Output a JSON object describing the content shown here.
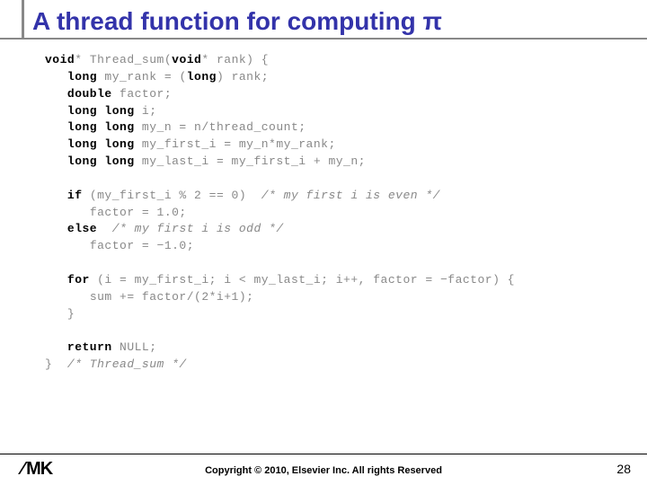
{
  "slide": {
    "title": "A thread function for computing π",
    "copyright": "Copyright © 2010, Elsevier Inc. All rights Reserved",
    "page_number": "28",
    "logo_text": "MK"
  },
  "code": {
    "lines": [
      {
        "indent": 0,
        "segs": [
          {
            "t": "void",
            "c": "kw"
          },
          {
            "t": "* Thread_sum("
          },
          {
            "t": "void",
            "c": "kw"
          },
          {
            "t": "* rank) {"
          }
        ]
      },
      {
        "indent": 1,
        "segs": [
          {
            "t": "long",
            "c": "kw"
          },
          {
            "t": " my_rank = ("
          },
          {
            "t": "long",
            "c": "kw"
          },
          {
            "t": ") rank;"
          }
        ]
      },
      {
        "indent": 1,
        "segs": [
          {
            "t": "double",
            "c": "kw"
          },
          {
            "t": " factor;"
          }
        ]
      },
      {
        "indent": 1,
        "segs": [
          {
            "t": "long long",
            "c": "kw"
          },
          {
            "t": " i;"
          }
        ]
      },
      {
        "indent": 1,
        "segs": [
          {
            "t": "long long",
            "c": "kw"
          },
          {
            "t": " my_n = n/thread_count;"
          }
        ]
      },
      {
        "indent": 1,
        "segs": [
          {
            "t": "long long",
            "c": "kw"
          },
          {
            "t": " my_first_i = my_n*my_rank;"
          }
        ]
      },
      {
        "indent": 1,
        "segs": [
          {
            "t": "long long",
            "c": "kw"
          },
          {
            "t": " my_last_i = my_first_i + my_n;"
          }
        ]
      },
      {
        "indent": 0,
        "segs": [
          {
            "t": " "
          }
        ]
      },
      {
        "indent": 1,
        "segs": [
          {
            "t": "if",
            "c": "kw"
          },
          {
            "t": " (my_first_i % 2 == 0)  "
          },
          {
            "t": "/* my first i is even */",
            "c": "cm"
          }
        ]
      },
      {
        "indent": 2,
        "segs": [
          {
            "t": "factor = 1.0;"
          }
        ]
      },
      {
        "indent": 1,
        "segs": [
          {
            "t": "else",
            "c": "kw"
          },
          {
            "t": "  "
          },
          {
            "t": "/* my first i is odd */",
            "c": "cm"
          }
        ]
      },
      {
        "indent": 2,
        "segs": [
          {
            "t": "factor = −1.0;"
          }
        ]
      },
      {
        "indent": 0,
        "segs": [
          {
            "t": " "
          }
        ]
      },
      {
        "indent": 1,
        "segs": [
          {
            "t": "for",
            "c": "kw"
          },
          {
            "t": " (i = my_first_i; i < my_last_i; i++, factor = −factor) {"
          }
        ]
      },
      {
        "indent": 2,
        "segs": [
          {
            "t": "sum += factor/(2*i+1);"
          }
        ]
      },
      {
        "indent": 1,
        "segs": [
          {
            "t": "}"
          }
        ]
      },
      {
        "indent": 0,
        "segs": [
          {
            "t": " "
          }
        ]
      },
      {
        "indent": 1,
        "segs": [
          {
            "t": "return",
            "c": "kw"
          },
          {
            "t": " NULL;"
          }
        ]
      },
      {
        "indent": 0,
        "segs": [
          {
            "t": "}  "
          },
          {
            "t": "/* Thread_sum */",
            "c": "cm"
          }
        ]
      }
    ]
  }
}
